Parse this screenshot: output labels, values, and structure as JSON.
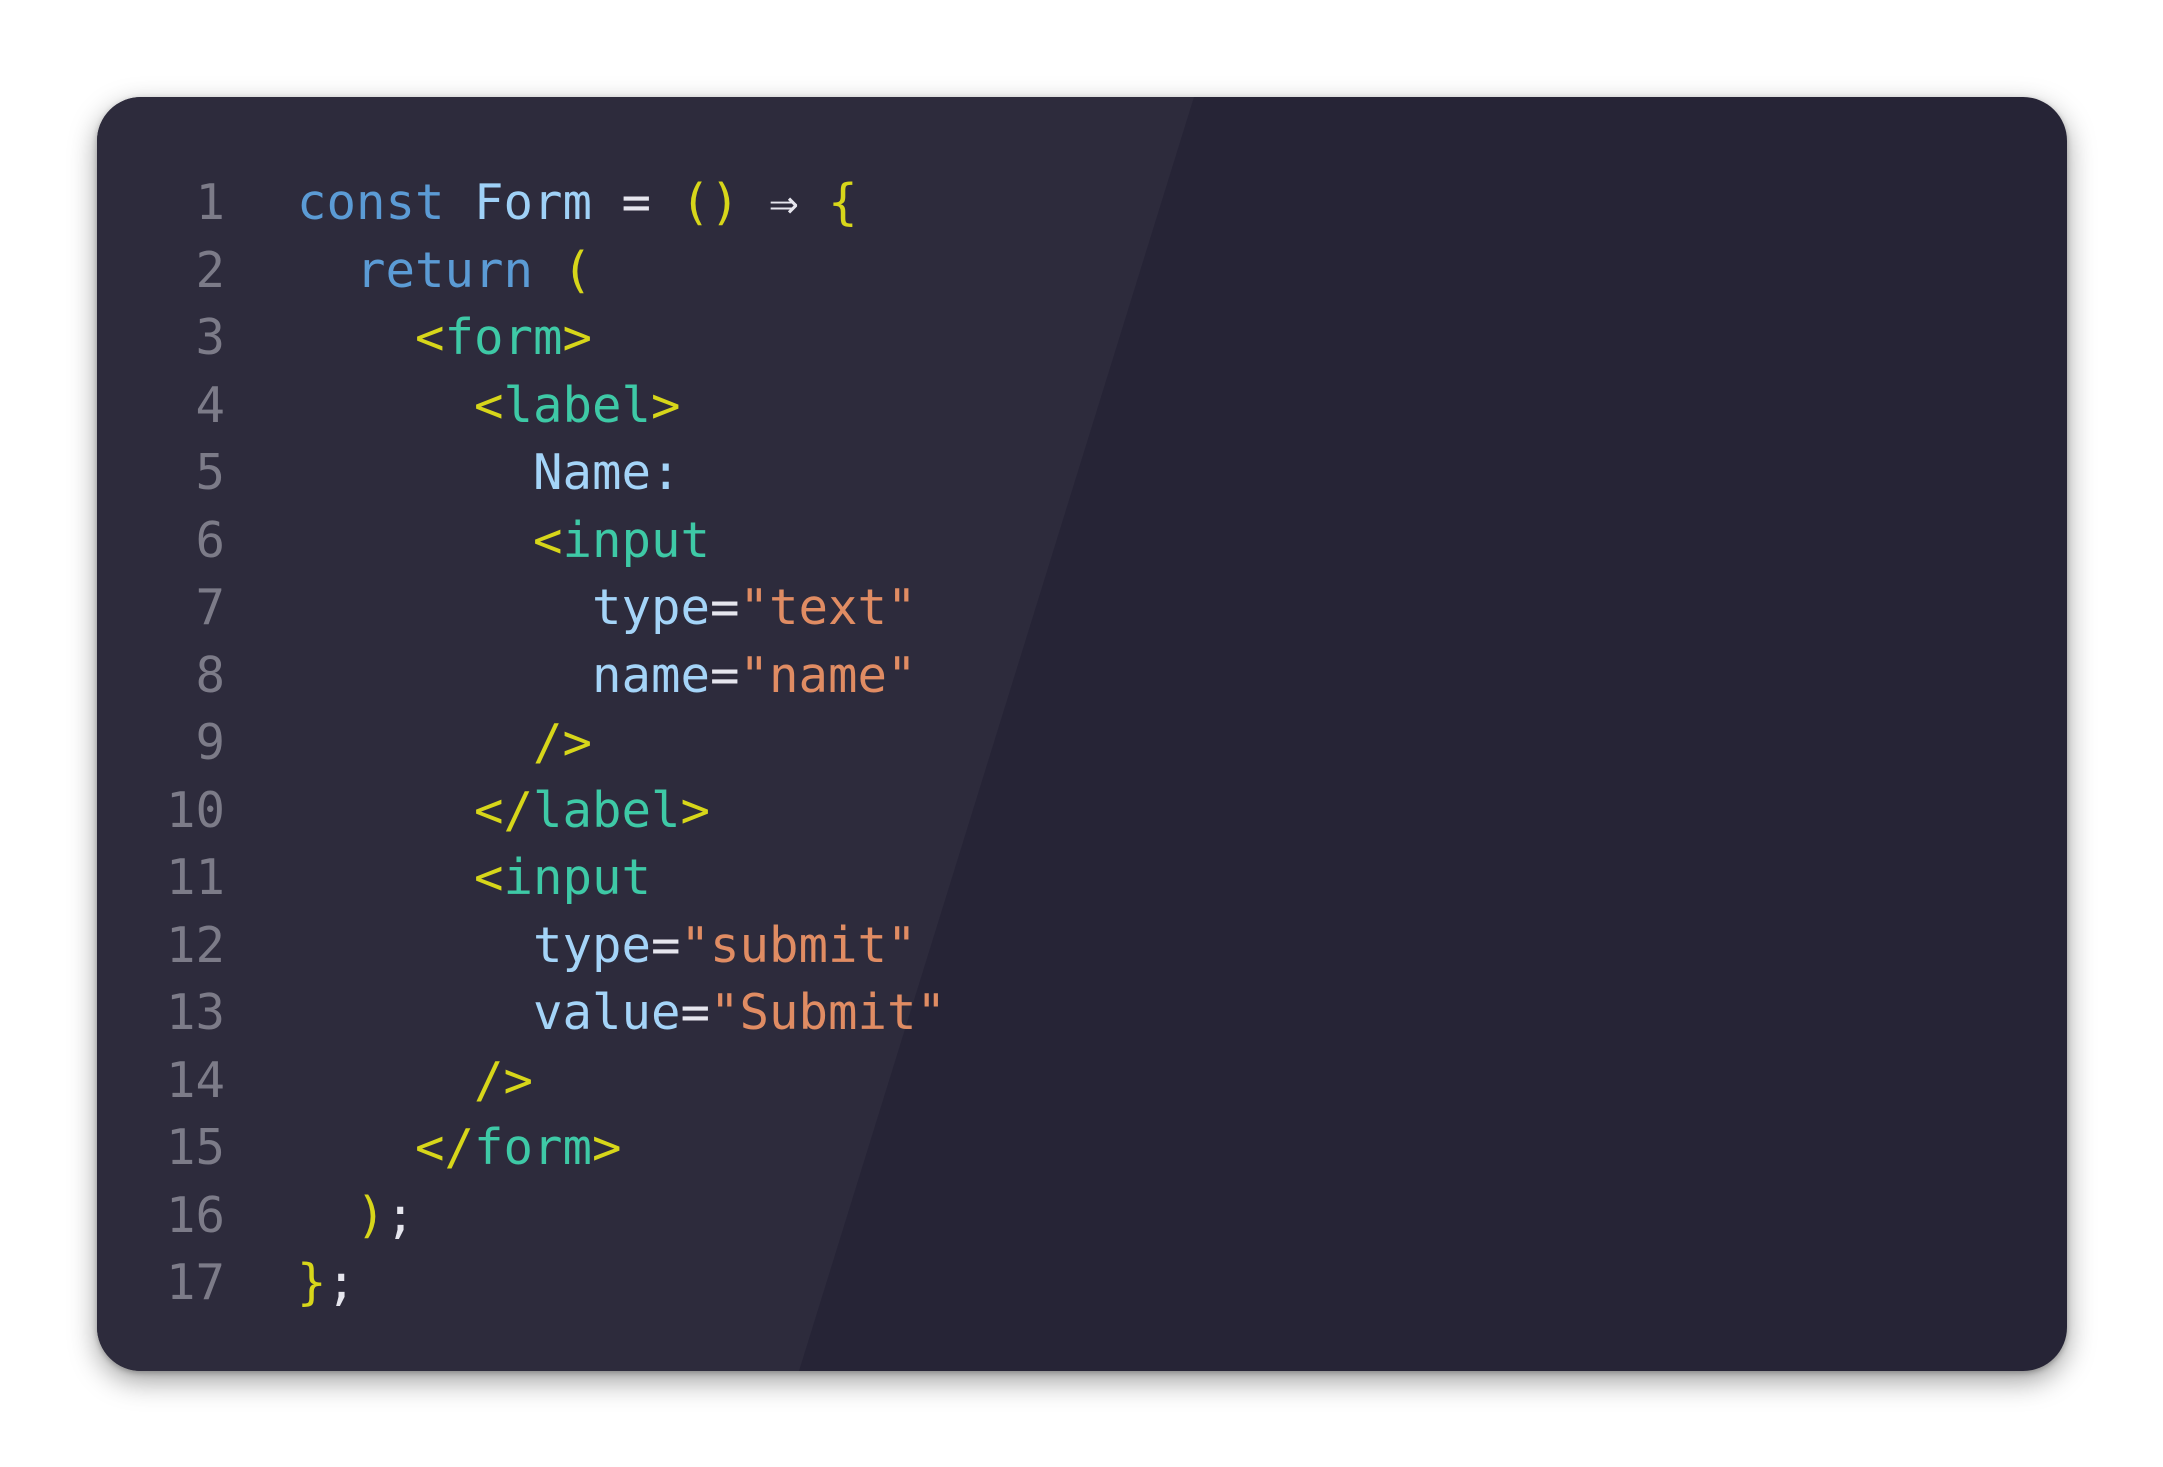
{
  "editor": {
    "theme_colors": {
      "background": "#262436",
      "keyword": "#5b9bd5",
      "identifier": "#9fd1f7",
      "bracket": "#d7d61a",
      "tag": "#3ec9a6",
      "attribute": "#a4d4f8",
      "string": "#e08c63",
      "line_number": "#7c7b88"
    },
    "lines": [
      {
        "num": "1",
        "tokens": [
          {
            "t": "const",
            "c": "kw"
          },
          {
            "t": " ",
            "c": "op"
          },
          {
            "t": "Form",
            "c": "id"
          },
          {
            "t": " = ",
            "c": "op"
          },
          {
            "t": "()",
            "c": "br"
          },
          {
            "t": " ⇒ ",
            "c": "op"
          },
          {
            "t": "{",
            "c": "br"
          }
        ]
      },
      {
        "num": "2",
        "tokens": [
          {
            "t": "  ",
            "c": "op"
          },
          {
            "t": "return",
            "c": "kw"
          },
          {
            "t": " ",
            "c": "op"
          },
          {
            "t": "(",
            "c": "br"
          }
        ]
      },
      {
        "num": "3",
        "tokens": [
          {
            "t": "    ",
            "c": "op"
          },
          {
            "t": "<",
            "c": "br"
          },
          {
            "t": "form",
            "c": "tag"
          },
          {
            "t": ">",
            "c": "br"
          }
        ]
      },
      {
        "num": "4",
        "tokens": [
          {
            "t": "      ",
            "c": "op"
          },
          {
            "t": "<",
            "c": "br"
          },
          {
            "t": "label",
            "c": "tag"
          },
          {
            "t": ">",
            "c": "br"
          }
        ]
      },
      {
        "num": "5",
        "tokens": [
          {
            "t": "        ",
            "c": "op"
          },
          {
            "t": "Name:",
            "c": "txt"
          }
        ]
      },
      {
        "num": "6",
        "tokens": [
          {
            "t": "        ",
            "c": "op"
          },
          {
            "t": "<",
            "c": "br"
          },
          {
            "t": "input",
            "c": "tag"
          }
        ]
      },
      {
        "num": "7",
        "tokens": [
          {
            "t": "          ",
            "c": "op"
          },
          {
            "t": "type",
            "c": "attr"
          },
          {
            "t": "=",
            "c": "pun"
          },
          {
            "t": "\"text\"",
            "c": "str"
          }
        ]
      },
      {
        "num": "8",
        "tokens": [
          {
            "t": "          ",
            "c": "op"
          },
          {
            "t": "name",
            "c": "attr"
          },
          {
            "t": "=",
            "c": "pun"
          },
          {
            "t": "\"name\"",
            "c": "str"
          }
        ]
      },
      {
        "num": "9",
        "tokens": [
          {
            "t": "        ",
            "c": "op"
          },
          {
            "t": "/>",
            "c": "br"
          }
        ]
      },
      {
        "num": "10",
        "tokens": [
          {
            "t": "      ",
            "c": "op"
          },
          {
            "t": "</",
            "c": "br"
          },
          {
            "t": "label",
            "c": "tag"
          },
          {
            "t": ">",
            "c": "br"
          }
        ]
      },
      {
        "num": "11",
        "tokens": [
          {
            "t": "      ",
            "c": "op"
          },
          {
            "t": "<",
            "c": "br"
          },
          {
            "t": "input",
            "c": "tag"
          }
        ]
      },
      {
        "num": "12",
        "tokens": [
          {
            "t": "        ",
            "c": "op"
          },
          {
            "t": "type",
            "c": "attr"
          },
          {
            "t": "=",
            "c": "pun"
          },
          {
            "t": "\"submit\"",
            "c": "str"
          }
        ]
      },
      {
        "num": "13",
        "tokens": [
          {
            "t": "        ",
            "c": "op"
          },
          {
            "t": "value",
            "c": "attr"
          },
          {
            "t": "=",
            "c": "pun"
          },
          {
            "t": "\"Submit\"",
            "c": "str"
          }
        ]
      },
      {
        "num": "14",
        "tokens": [
          {
            "t": "      ",
            "c": "op"
          },
          {
            "t": "/>",
            "c": "br"
          }
        ]
      },
      {
        "num": "15",
        "tokens": [
          {
            "t": "    ",
            "c": "op"
          },
          {
            "t": "</",
            "c": "br"
          },
          {
            "t": "form",
            "c": "tag"
          },
          {
            "t": ">",
            "c": "br"
          }
        ]
      },
      {
        "num": "16",
        "tokens": [
          {
            "t": "  ",
            "c": "op"
          },
          {
            "t": ")",
            "c": "br"
          },
          {
            "t": ";",
            "c": "pun"
          }
        ]
      },
      {
        "num": "17",
        "tokens": [
          {
            "t": "}",
            "c": "br"
          },
          {
            "t": ";",
            "c": "pun"
          }
        ]
      }
    ]
  }
}
